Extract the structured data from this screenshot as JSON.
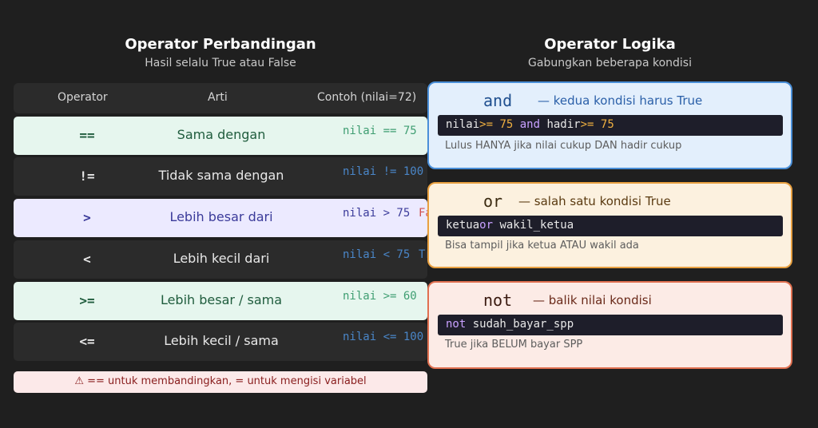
{
  "left": {
    "title": "Operator Perbandingan",
    "subtitle": "Hasil selalu True atau False",
    "headers": {
      "operator": "Operator",
      "arti": "Arti",
      "contoh": "Contoh (nilai=72)"
    },
    "rows": [
      {
        "op": "==",
        "arti": "Sama dengan",
        "contoh": "nilai == 75",
        "overlap": "False",
        "bg": "#e6f6ee",
        "text": "#1f5c3d",
        "code": "#3f9e72",
        "overlap_color": "#d05050"
      },
      {
        "op": "!=",
        "arti": "Tidak sama dengan",
        "contoh": "nilai != 100",
        "overlap": "True",
        "bg": "#2b2b2b",
        "text": "#e8e8e8",
        "code": "#4a86c8",
        "overlap_color": "#4a86c8"
      },
      {
        "op": ">",
        "arti": "Lebih besar dari",
        "contoh": "nilai > 75",
        "overlap": "False",
        "bg": "#eceaff",
        "text": "#3b3b9a",
        "code": "#3b3b9a",
        "overlap_color": "#d05050"
      },
      {
        "op": "<",
        "arti": "Lebih kecil dari",
        "contoh": "nilai < 75",
        "overlap": "True",
        "bg": "#2b2b2b",
        "text": "#e8e8e8",
        "code": "#4a86c8",
        "overlap_color": "#4a86c8"
      },
      {
        "op": ">=",
        "arti": "Lebih besar / sama",
        "contoh": "nilai >= 60",
        "overlap": "True",
        "bg": "#e6f6ee",
        "text": "#1f5c3d",
        "code": "#3f9e72",
        "overlap_color": "#3f9e72"
      },
      {
        "op": "<=",
        "arti": "Lebih kecil / sama",
        "contoh": "nilai <= 100",
        "overlap": "True",
        "bg": "#2b2b2b",
        "text": "#e8e8e8",
        "code": "#4a86c8",
        "overlap_color": "#4a86c8"
      }
    ],
    "warning": "⚠ == untuk membandingkan, = untuk mengisi variabel"
  },
  "right": {
    "title": "Operator Logika",
    "subtitle": "Gabungkan beberapa kondisi",
    "cards": [
      {
        "keyword": "and",
        "desc": "— kedua kondisi harus True",
        "code_parts": [
          {
            "text": "nilai",
            "color": "#e8e8e8"
          },
          {
            "text": ">= 75 ",
            "color": "#f0b040"
          },
          {
            "text": "and ",
            "color": "#c8a0ff"
          },
          {
            "text": "hadir",
            "color": "#e8e8e8"
          },
          {
            "text": ">= 75",
            "color": "#f0b040"
          }
        ],
        "note": "Lulus HANYA jika nilai cukup DAN hadir cukup",
        "bg": "#e3effc",
        "border": "#4a8fd8",
        "kw_color": "#1f4f8f",
        "desc_color": "#2a5fa8"
      },
      {
        "keyword": "or",
        "desc": "— salah satu kondisi True",
        "code_parts": [
          {
            "text": "ketua",
            "color": "#e8e8e8"
          },
          {
            "text": "or ",
            "color": "#c8a0ff"
          },
          {
            "text": "wakil_ketua",
            "color": "#e8e8e8"
          }
        ],
        "note": "Bisa tampil jika ketua ATAU wakil ada",
        "bg": "#fcf1df",
        "border": "#e8a040",
        "kw_color": "#3a2a10",
        "desc_color": "#5a3a10"
      },
      {
        "keyword": "not",
        "desc": "— balik nilai kondisi",
        "code_parts": [
          {
            "text": "not ",
            "color": "#c8a0ff"
          },
          {
            "text": "sudah_bayar_spp",
            "color": "#e8e8e8"
          }
        ],
        "note": "True jika BELUM bayar SPP",
        "bg": "#fcebe6",
        "border": "#e07050",
        "kw_color": "#3a1a10",
        "desc_color": "#6a2a1a"
      }
    ]
  }
}
